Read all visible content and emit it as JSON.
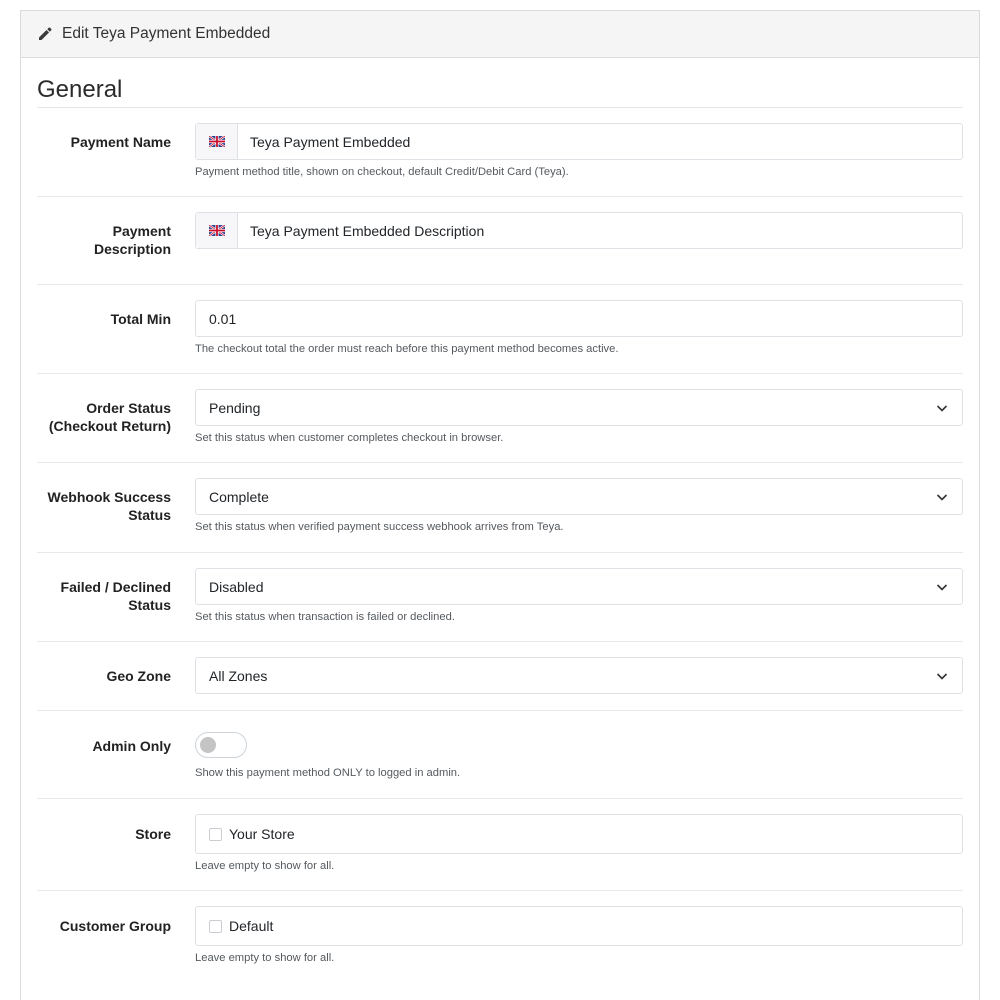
{
  "header": {
    "title": "Edit Teya Payment Embedded",
    "icon": "pencil-icon"
  },
  "section": {
    "title": "General"
  },
  "fields": {
    "payment_name": {
      "label": "Payment Name",
      "value": "Teya Payment Embedded",
      "flag_icon": "uk-flag-icon",
      "help": "Payment method title, shown on checkout, default Credit/Debit Card (Teya)."
    },
    "payment_description": {
      "label_line1": "Payment",
      "label_line2": "Description",
      "value": "Teya Payment Embedded Description",
      "flag_icon": "uk-flag-icon"
    },
    "total_min": {
      "label": "Total Min",
      "value": "0.01",
      "help": "The checkout total the order must reach before this payment method becomes active."
    },
    "order_status": {
      "label_line1": "Order Status",
      "label_line2": "(Checkout Return)",
      "value": "Pending",
      "help": "Set this status when customer completes checkout in browser."
    },
    "webhook_status": {
      "label_line1": "Webhook Success",
      "label_line2": "Status",
      "value": "Complete",
      "help": "Set this status when verified payment success webhook arrives from Teya."
    },
    "failed_status": {
      "label_line1": "Failed / Declined",
      "label_line2": "Status",
      "value": "Disabled",
      "help": "Set this status when transaction is failed or declined."
    },
    "geo_zone": {
      "label": "Geo Zone",
      "value": "All Zones"
    },
    "admin_only": {
      "label": "Admin Only",
      "enabled": false,
      "help": "Show this payment method ONLY to logged in admin."
    },
    "store": {
      "label": "Store",
      "option": "Your Store",
      "checked": false,
      "help": "Leave empty to show for all."
    },
    "customer_group": {
      "label": "Customer Group",
      "option": "Default",
      "checked": false,
      "help": "Leave empty to show for all."
    }
  },
  "colors": {
    "border": "#dee2e6",
    "header_bg": "#f5f5f5",
    "prefix_bg": "#f7f7f9"
  }
}
